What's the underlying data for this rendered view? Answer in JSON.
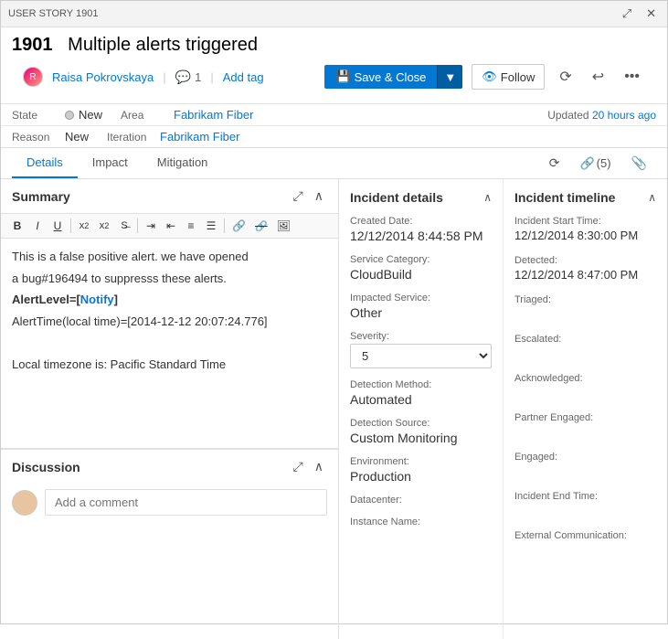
{
  "titleBar": {
    "label": "USER STORY  1901",
    "maximizeTitle": "Maximize",
    "closeTitle": "Close"
  },
  "header": {
    "storyId": "1901",
    "storyTitle": "Multiple alerts triggered"
  },
  "toolbar": {
    "assignee": "Raisa Pokrovskaya",
    "commentCount": "1",
    "addTagLabel": "Add tag",
    "saveLabel": "Save & Close",
    "followLabel": "Follow"
  },
  "fields": {
    "stateLabel": "State",
    "stateValue": "New",
    "areaLabel": "Area",
    "areaValue": "Fabrikam Fiber",
    "reasonLabel": "Reason",
    "reasonValue": "New",
    "iterationLabel": "Iteration",
    "iterationValue": "Fabrikam Fiber",
    "updatedText": "Updated",
    "updatedTime": "20 hours ago"
  },
  "tabs": {
    "details": "Details",
    "impact": "Impact",
    "mitigation": "Mitigation",
    "historyIcon": "↺",
    "linkCount": "(5)",
    "attachIcon": "📎"
  },
  "summary": {
    "sectionTitle": "Summary",
    "content": [
      "This is a false positive alert. we have opened",
      "a bug#196494 to suppresss these alerts.",
      "AlertLevel=[Notify]",
      "AlertTime(local time)=[2014-12-12 20:07:24.776]",
      "",
      "Local timezone is: Pacific Standard Time"
    ],
    "notifyText": "Notify"
  },
  "discussion": {
    "sectionTitle": "Discussion",
    "placeholder": "Add a comment"
  },
  "incidentDetails": {
    "title": "Incident details",
    "createdDateLabel": "Created Date:",
    "createdDateValue": "12/12/2014 8:44:58 PM",
    "serviceCategoryLabel": "Service Category:",
    "serviceCategoryValue": "CloudBuild",
    "impactedServiceLabel": "Impacted Service:",
    "impactedServiceValue": "Other",
    "severityLabel": "Severity:",
    "severityValue": "5",
    "detectionMethodLabel": "Detection Method:",
    "detectionMethodValue": "Automated",
    "detectionSourceLabel": "Detection Source:",
    "detectionSourceValue": "Custom Monitoring",
    "environmentLabel": "Environment:",
    "environmentValue": "Production",
    "datacenterLabel": "Datacenter:",
    "datacenterValue": "",
    "instanceNameLabel": "Instance Name:",
    "instanceNameValue": ""
  },
  "incidentTimeline": {
    "title": "Incident timeline",
    "startTimeLabel": "Incident Start Time:",
    "startTimeValue": "12/12/2014 8:30:00 PM",
    "detectedLabel": "Detected:",
    "detectedValue": "12/12/2014 8:47:00 PM",
    "triagedLabel": "Triaged:",
    "triagedValue": "",
    "escalatedLabel": "Escalated:",
    "escalatedValue": "",
    "acknowledgedLabel": "Acknowledged:",
    "acknowledgedValue": "",
    "partnerEngagedLabel": "Partner Engaged:",
    "partnerEngagedValue": "",
    "engagedLabel": "Engaged:",
    "engagedValue": "",
    "endTimeLabel": "Incident End Time:",
    "endTimeValue": "",
    "externalCommLabel": "External Communication:",
    "externalCommValue": ""
  },
  "icons": {
    "bold": "B",
    "italic": "I",
    "underline": "U",
    "strikethrough": "S",
    "subscript": "x₂",
    "superscript": "x²",
    "indent": "⇥",
    "outdent": "⇤",
    "insertLink": "🔗",
    "insertImage": "🖼",
    "expand": "⤢",
    "collapse": "∧",
    "history": "⟳",
    "link": "🔗",
    "attachment": "📎"
  }
}
